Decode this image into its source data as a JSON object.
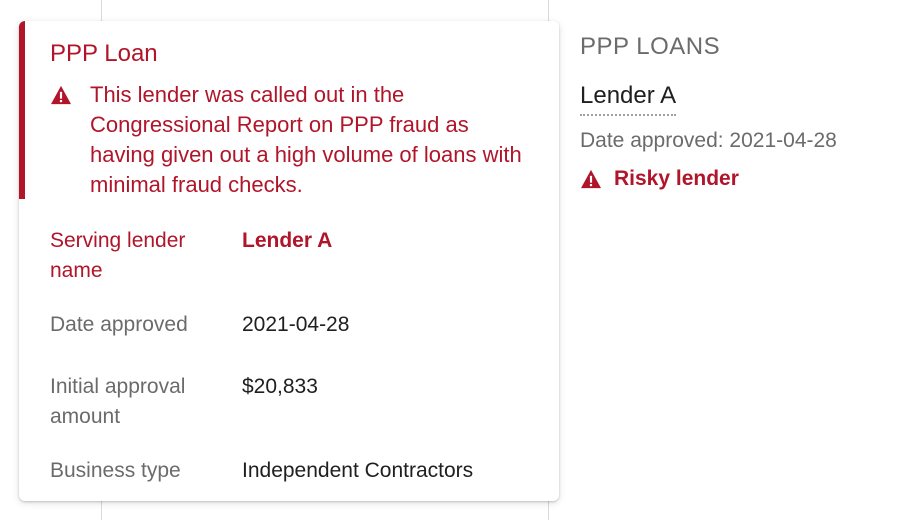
{
  "tooltip": {
    "title": "PPP Loan",
    "warning": "This lender was called out in the Congressional Report on PPP fraud as having given out a high volume of loans with minimal fraud checks.",
    "rows": [
      {
        "label": "Serving lender name",
        "value": "Lender A",
        "risky": true
      },
      {
        "label": "Date approved",
        "value": "2021-04-28",
        "risky": false
      },
      {
        "label": "Initial approval amount",
        "value": "$20,833",
        "risky": false
      },
      {
        "label": "Business type",
        "value": "Independent Contractors",
        "risky": false
      }
    ],
    "icon": "warning-icon"
  },
  "panel": {
    "section_title": "PPP LOANS",
    "lender": "Lender A",
    "date_approved": "Date approved: 2021-04-28",
    "risk_label": "Risky lender",
    "icon": "warning-icon"
  },
  "colors": {
    "risk": "#b0152a",
    "label": "#6b6b6b",
    "text": "#202020"
  }
}
